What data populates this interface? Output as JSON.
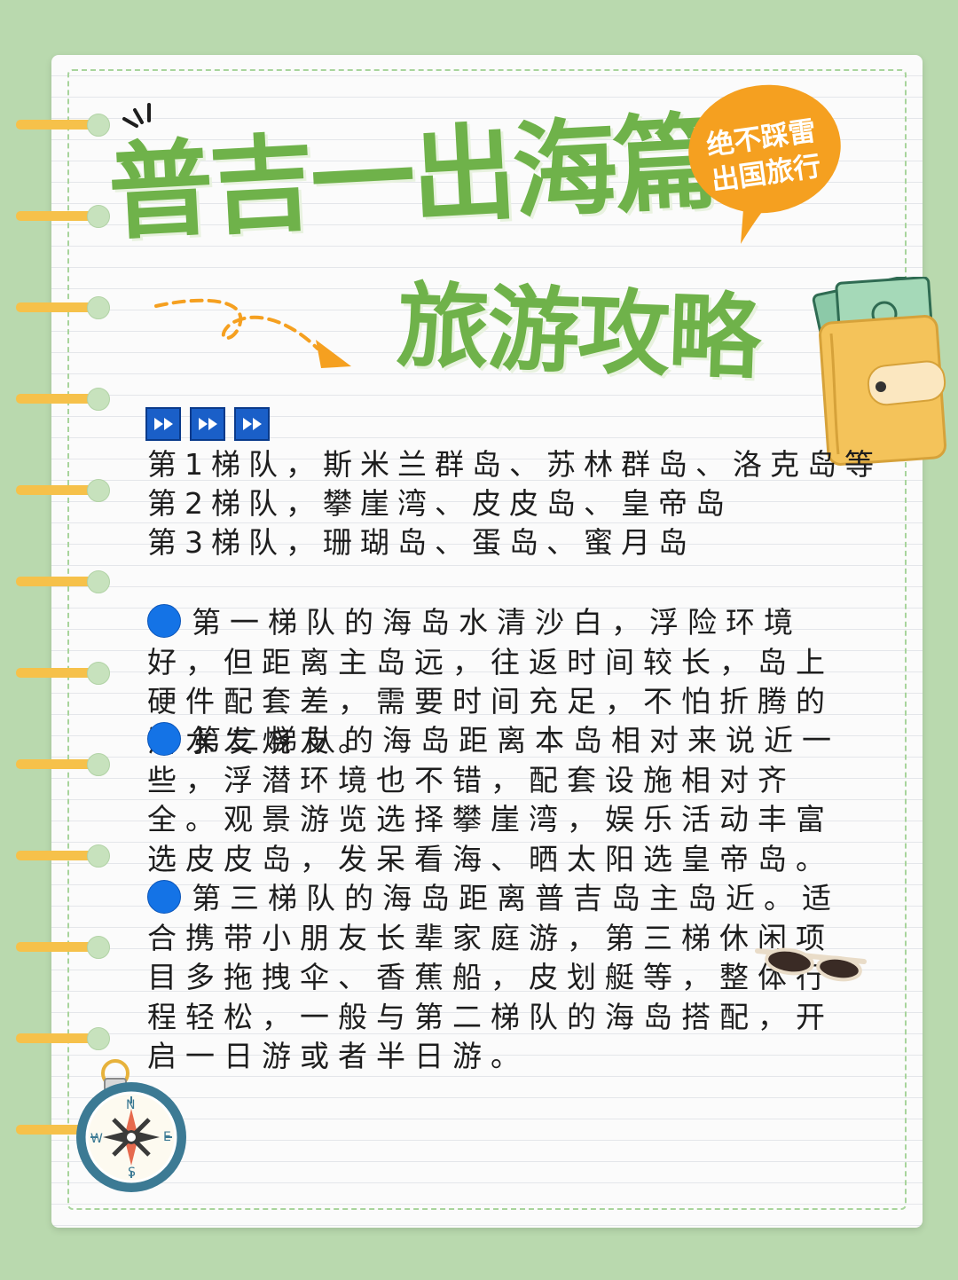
{
  "title": {
    "line1": "普吉一出海篇",
    "line2": "旅游攻略"
  },
  "badge": {
    "line1": "绝不踩雷",
    "line2": "出国旅行"
  },
  "tiers": [
    "第1梯队，斯米兰群岛、苏林群岛、洛克岛等",
    "第2梯队，攀崖湾、皮皮岛、皇帝岛",
    "第3梯队，珊瑚岛、蛋岛、蜜月岛"
  ],
  "paragraphs": [
    "第一梯队的海岛水清沙白，浮险环境好，但距离主岛远，往返时间较长，岛上硬件配套差，需要时间充足，不怕折腾的潜水发烧友。",
    "第二梯队的海岛距离本岛相对来说近一些，浮潜环境也不错，配套设施相对齐全。观景游览选择攀崖湾，娱乐活动丰富选皮皮岛，发呆看海、晒太阳选皇帝岛。",
    "第三梯队的海岛距离普吉岛主岛近。适合携带小朋友长辈家庭游，第三梯休闲项目多拖拽伞、香蕉船，皮划艇等，整体行程轻松，一般与第二梯队的海岛搭配，开启一日游或者半日游。"
  ],
  "icons": {
    "fast_forward": "fast-forward-icon",
    "bullet": "blue-circle-icon",
    "compass": "compass-icon",
    "wallet": "wallet-icon",
    "sunglasses": "sunglasses-icon",
    "arrow": "dashed-arrow-icon"
  },
  "compass_letters": [
    "N",
    "E",
    "S",
    "W"
  ],
  "colors": {
    "background": "#b9d9ae",
    "title_green": "#6fb24a",
    "badge_orange": "#f5a020",
    "ring_yellow": "#f6c14a",
    "button_blue": "#1a5fc8",
    "bullet_blue": "#1473e6",
    "text": "#1d1d1d"
  }
}
